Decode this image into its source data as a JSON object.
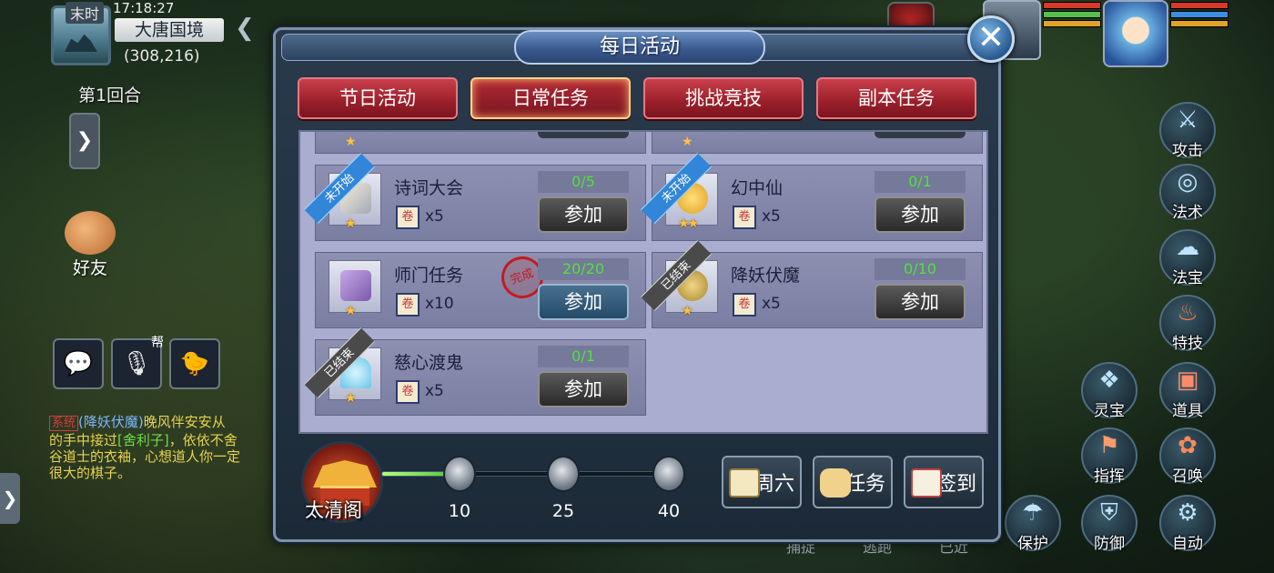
{
  "hud": {
    "time_label": "末时",
    "clock": "17:18:27",
    "location_name": "大唐国境",
    "coordinates": "(308,216)",
    "round_text": "第1回合",
    "friend_label": "好友",
    "chat_mini": "帮"
  },
  "system_log": {
    "tag": "系统",
    "line1_pre": "(降妖伏魔)",
    "line1_mid": "晚风伴安安从",
    "line2_pre": "的手中接过",
    "item": "[舍利子]",
    "line2_post": "，依依不舍",
    "line3": "谷道士的衣袖，心想道人你一定",
    "line4": "很大的棋子。"
  },
  "right_skills": [
    {
      "label": "攻击",
      "icon": "sword-icon"
    },
    {
      "label": "法术",
      "icon": "magic-swirl-icon"
    },
    {
      "label": "法宝",
      "icon": "treasure-cloud-icon"
    },
    {
      "label": "特技",
      "icon": "flame-icon"
    },
    {
      "label": "灵宝",
      "icon": "spirit-treasure-icon"
    },
    {
      "label": "道具",
      "icon": "chest-icon"
    },
    {
      "label": "指挥",
      "icon": "banner-icon"
    },
    {
      "label": "召唤",
      "icon": "pet-icon"
    },
    {
      "label": "保护",
      "icon": "umbrella-icon"
    },
    {
      "label": "防御",
      "icon": "shield-icon"
    },
    {
      "label": "自动",
      "icon": "gear-icon"
    }
  ],
  "bottom_labels": [
    "捕捉",
    "逃跑",
    "已近"
  ],
  "panel": {
    "title": "每日活动",
    "tabs": [
      {
        "label": "节日活动",
        "active": false
      },
      {
        "label": "日常任务",
        "active": true
      },
      {
        "label": "挑战竞技",
        "active": false
      },
      {
        "label": "副本任务",
        "active": false
      }
    ],
    "activities": [
      {
        "name": "诗词大会",
        "progress": "0/5",
        "reward": "x5",
        "stars": "★",
        "ribbon": "未开始",
        "ribbon_style": "blue",
        "button": "参加",
        "completed": false,
        "icon": "scroll-book-icon"
      },
      {
        "name": "幻中仙",
        "progress": "0/1",
        "reward": "x5",
        "stars": "★★",
        "ribbon": "未开始",
        "ribbon_style": "blue",
        "button": "参加",
        "completed": false,
        "icon": "golden-leaf-icon"
      },
      {
        "name": "师门任务",
        "progress": "20/20",
        "reward": "x10",
        "stars": "★",
        "ribbon": "",
        "ribbon_style": "",
        "button": "参加",
        "completed": true,
        "stamp": "完成",
        "icon": "scroll-icon"
      },
      {
        "name": "降妖伏魔",
        "progress": "0/10",
        "reward": "x5",
        "stars": "★",
        "ribbon": "已结束",
        "ribbon_style": "gray",
        "button": "参加",
        "completed": false,
        "icon": "bell-icon"
      },
      {
        "name": "慈心渡鬼",
        "progress": "0/1",
        "reward": "x5",
        "stars": "★",
        "ribbon": "已结束",
        "ribbon_style": "gray",
        "button": "参加",
        "completed": false,
        "icon": "ghost-icon"
      }
    ],
    "activity_points": {
      "pavilion_name": "太清阁",
      "progress_fraction": 0.25,
      "milestones": [
        "10",
        "25",
        "40"
      ]
    },
    "footer_buttons": [
      {
        "label": "周六",
        "icon": "calendar-icon"
      },
      {
        "label": "任务",
        "icon": "scroll-icon"
      },
      {
        "label": "签到",
        "icon": "checkin-icon"
      }
    ],
    "close_glyph": "✕"
  }
}
